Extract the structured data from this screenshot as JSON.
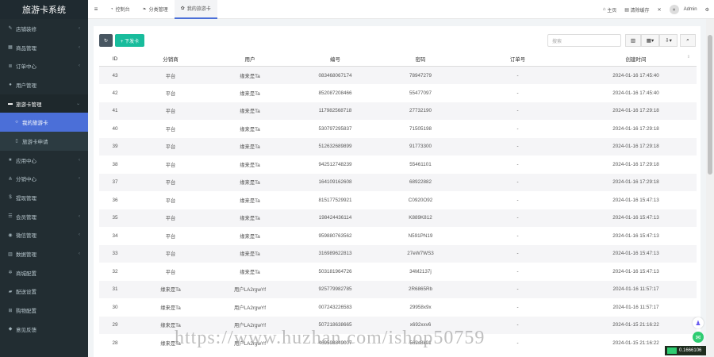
{
  "app": {
    "title": "旅游卡系统"
  },
  "sidebar": {
    "items": [
      {
        "label": "店铺装修",
        "icon": "brush-icon",
        "chevron": "‹"
      },
      {
        "label": "商品管理",
        "icon": "box-icon",
        "chevron": "‹"
      },
      {
        "label": "订单中心",
        "icon": "list-icon",
        "chevron": "‹"
      },
      {
        "label": "用户管理",
        "icon": "user-icon",
        "chevron": ""
      },
      {
        "label": "旅游卡管理",
        "icon": "card-icon",
        "chevron": "⌄"
      },
      {
        "label": "我的旅游卡",
        "icon": "circle-icon",
        "chevron": ""
      },
      {
        "label": "旅游卡申请",
        "icon": "doc-icon",
        "chevron": ""
      },
      {
        "label": "应用中心",
        "icon": "star-icon",
        "chevron": "‹"
      },
      {
        "label": "分销中心",
        "icon": "share-icon",
        "chevron": "‹"
      },
      {
        "label": "提现管理",
        "icon": "dollar-icon",
        "chevron": ""
      },
      {
        "label": "会员管理",
        "icon": "members-icon",
        "chevron": "‹"
      },
      {
        "label": "微信管理",
        "icon": "wechat-icon",
        "chevron": "‹"
      },
      {
        "label": "数据管理",
        "icon": "chart-icon",
        "chevron": "‹"
      },
      {
        "label": "商城配置",
        "icon": "gears-icon",
        "chevron": ""
      },
      {
        "label": "配送设置",
        "icon": "truck-icon",
        "chevron": ""
      },
      {
        "label": "购物配置",
        "icon": "cart-icon",
        "chevron": ""
      },
      {
        "label": "意见反馈",
        "icon": "comment-icon",
        "chevron": ""
      }
    ]
  },
  "topbar": {
    "menu_icon": "≡",
    "tabs": [
      {
        "label": "控制台",
        "icon": "dashboard-icon"
      },
      {
        "label": "分类管理",
        "icon": "leaf-icon"
      },
      {
        "label": "我的旅游卡",
        "icon": "gear-icon"
      }
    ],
    "home": "主页",
    "clear_cache": "清除缓存",
    "user": "Admin"
  },
  "toolbar": {
    "add_label": "+ 下发卡",
    "search_placeholder": "搜索"
  },
  "table": {
    "columns": [
      "ID",
      "分销商",
      "用户",
      "编号",
      "密码",
      "订单号",
      "创建时间"
    ],
    "rows": [
      [
        "43",
        "平台",
        "缘来是Ta",
        "083468067174",
        "78947279",
        "-",
        "2024-01-16 17:45:40"
      ],
      [
        "42",
        "平台",
        "缘来是Ta",
        "852087208466",
        "55477097",
        "-",
        "2024-01-16 17:45:40"
      ],
      [
        "41",
        "平台",
        "缘来是Ta",
        "117982568718",
        "27732190",
        "-",
        "2024-01-16 17:29:18"
      ],
      [
        "40",
        "平台",
        "缘来是Ta",
        "530797295837",
        "71505198",
        "-",
        "2024-01-16 17:29:18"
      ],
      [
        "39",
        "平台",
        "缘来是Ta",
        "512632689899",
        "91773300",
        "-",
        "2024-01-16 17:29:18"
      ],
      [
        "38",
        "平台",
        "缘来是Ta",
        "942512748239",
        "55461101",
        "-",
        "2024-01-16 17:29:18"
      ],
      [
        "37",
        "平台",
        "缘来是Ta",
        "164109162608",
        "68922882",
        "-",
        "2024-01-16 17:29:18"
      ],
      [
        "36",
        "平台",
        "缘来是Ta",
        "815177529921",
        "C0920O92",
        "-",
        "2024-01-16 15:47:13"
      ],
      [
        "35",
        "平台",
        "缘来是Ta",
        "198424436114",
        "K889K812",
        "-",
        "2024-01-16 15:47:13"
      ],
      [
        "34",
        "平台",
        "缘来是Ta",
        "959880763562",
        "N591PN19",
        "-",
        "2024-01-16 15:47:13"
      ],
      [
        "33",
        "平台",
        "缘来是Ta",
        "316989622813",
        "27eW7WS3",
        "-",
        "2024-01-16 15:47:13"
      ],
      [
        "32",
        "平台",
        "缘来是Ta",
        "503181964726",
        "34M2137j",
        "-",
        "2024-01-16 15:47:13"
      ],
      [
        "31",
        "缘来是Ta",
        "用户LA2rgwYf",
        "925779982785",
        "2R6865Rb",
        "-",
        "2024-01-16 11:57:17"
      ],
      [
        "30",
        "缘来是Ta",
        "用户LA2rgwYf",
        "007243226583",
        "29958x9x",
        "-",
        "2024-01-16 11:57:17"
      ],
      [
        "29",
        "缘来是Ta",
        "用户LA2rgwYf",
        "507218638665",
        "x692xxv6",
        "-",
        "2024-01-15 21:16:22"
      ],
      [
        "28",
        "缘来是Ta",
        "用户LA2rgwYf",
        "469598849007",
        "562s8k01",
        "-",
        "2024-01-15 21:16:22"
      ]
    ]
  },
  "footer": {
    "perf": "0.1666106",
    "watermark": "https://www.huzhan.com/ishop50759"
  },
  "colors": {
    "sidebar": "#222d32",
    "active": "#4b6fd8",
    "add": "#18bc9c"
  }
}
